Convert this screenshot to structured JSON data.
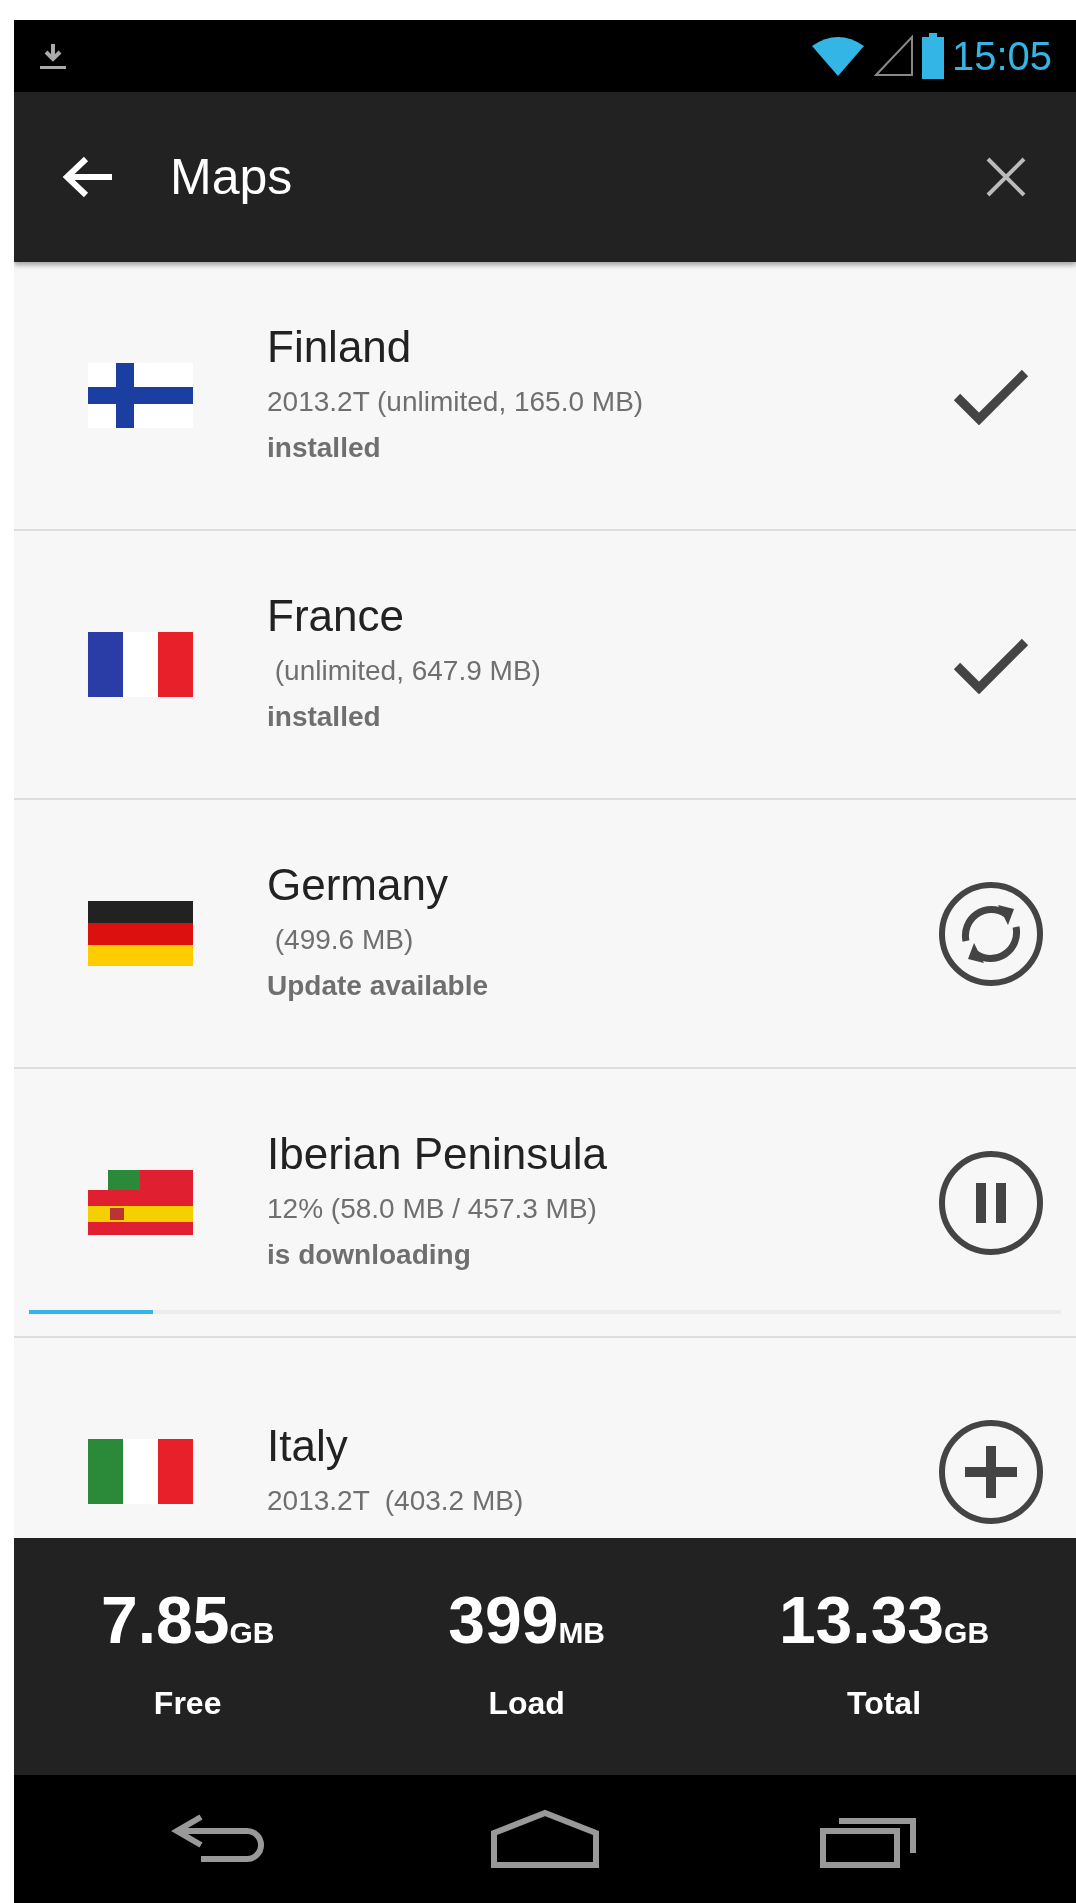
{
  "status_bar": {
    "time": "15:05"
  },
  "app_bar": {
    "title": "Maps"
  },
  "maps": [
    {
      "kind": "installed",
      "name": "Finland",
      "details": "2013.2T (unlimited, 165.0 MB)",
      "status": "installed"
    },
    {
      "kind": "installed",
      "name": "France",
      "details": " (unlimited, 647.9 MB)",
      "status": "installed"
    },
    {
      "kind": "outdated",
      "name": "Germany",
      "details": " (499.6 MB)",
      "status": "Update available"
    },
    {
      "kind": "downloading",
      "name": "Iberian Peninsula",
      "details": "12% (58.0 MB / 457.3 MB)",
      "status": "is downloading",
      "level": 0.12
    },
    {
      "kind": "available",
      "name": "Italy",
      "details": "2013.2T  (403.2 MB)"
    }
  ],
  "storage": [
    {
      "value": "7.85",
      "unit": "GB",
      "label": "Free"
    },
    {
      "value": "399",
      "unit": "MB",
      "label": "Load"
    },
    {
      "value": "13.33",
      "unit": "GB",
      "label": "Total"
    }
  ]
}
